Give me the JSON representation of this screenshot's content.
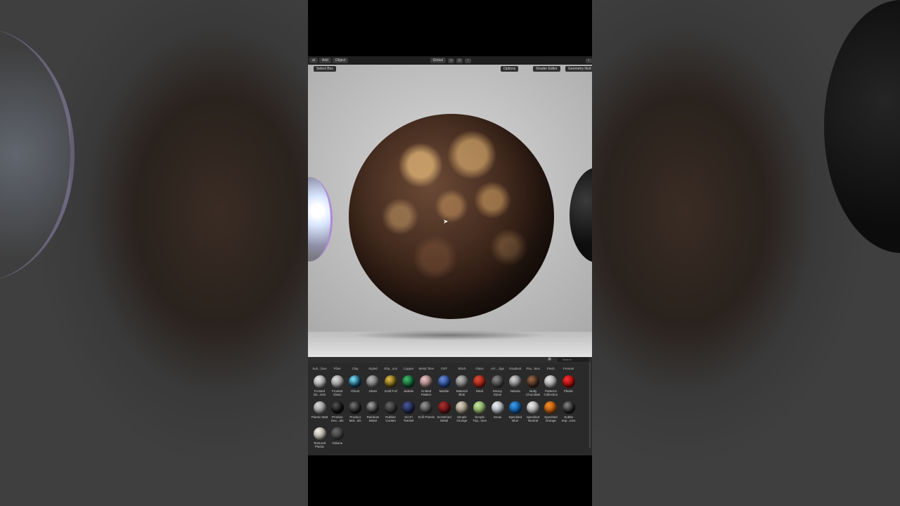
{
  "topbar": {
    "menu_first": "al",
    "menu_add": "Add",
    "menu_object": "Object",
    "transform_orientation": "Global"
  },
  "viewport": {
    "select_mode": "Select Box",
    "options_label": "Options",
    "shader_editor_label": "Shader Editor",
    "geometry_nodes_label": "Geometry Nod"
  },
  "browser": {
    "search_placeholder": "Search",
    "partial_row": [
      "Suh...face",
      "Fiber",
      "Clay",
      "Styled",
      "Shp...ons",
      "Copper",
      "Metal Tiles",
      "CRT",
      "Stitch",
      "Glass",
      "AO ...dge",
      "Gradient",
      "Pito...lass",
      "Flesh",
      "Fresnel"
    ],
    "assets": [
      {
        "label": "Frosted Dir...ions",
        "color": "#9a9a9a",
        "hl": "#e6e6e6"
      },
      {
        "label": "Frosted Glass",
        "color": "#8d8d8d",
        "hl": "#dcdcdc"
      },
      {
        "label": "Ghost",
        "color": "#0d3b55",
        "hl": "#7fe8ff"
      },
      {
        "label": "Glass",
        "color": "#666",
        "hl": "#bbb"
      },
      {
        "label": "Gold Foil",
        "color": "#5a4a10",
        "hl": "#e8c24a"
      },
      {
        "label": "Jadeite",
        "color": "#0e4a2a",
        "hl": "#3fbf6f"
      },
      {
        "label": "Knitted Pattern",
        "color": "#8a6a6a",
        "hl": "#f0c8c8"
      },
      {
        "label": "Marble",
        "color": "#1f3a7a",
        "hl": "#6a8ed8"
      },
      {
        "label": "Material Blob",
        "color": "#6a6a6a",
        "hl": "#c0c0c0"
      },
      {
        "label": "Meat",
        "color": "#8a1a10",
        "hl": "#e0503a"
      },
      {
        "label": "Mossy Stone",
        "color": "#3a3a3a",
        "hl": "#8a8a8a"
      },
      {
        "label": "Nebula",
        "color": "#6a6a6a",
        "hl": "#d8d8d8"
      },
      {
        "label": "Nutty Chocolate",
        "color": "#3a2418",
        "hl": "#9a6a4a"
      },
      {
        "label": "Patterns Collection",
        "color": "#9a9a9a",
        "hl": "#e6e6e6"
      },
      {
        "label": "Plastic",
        "color": "#8a0a0a",
        "hl": "#ff3030"
      },
      {
        "label": "Plastic Matt",
        "color": "#8a8a8a",
        "hl": "#dadada"
      },
      {
        "label": "Product Dec...als",
        "color": "#0a0a0a",
        "hl": "#555"
      },
      {
        "label": "Product Mat...als",
        "color": "#1a1a1a",
        "hl": "#777"
      },
      {
        "label": "Rainbow Metal",
        "color": "#2a2a2a",
        "hl": "#aaa"
      },
      {
        "label": "Rubber Curtain",
        "color": "#2a2a2a",
        "hl": "#666"
      },
      {
        "label": "Sci-Fi Trackel",
        "color": "#1a2040",
        "hl": "#4a5a9a"
      },
      {
        "label": "Scifi Panels",
        "color": "#3a3a3a",
        "hl": "#9a9a9a"
      },
      {
        "label": "Scratched Metal",
        "color": "#5a1010",
        "hl": "#b03030"
      },
      {
        "label": "Simple Grunge",
        "color": "#8a8070",
        "hl": "#e0d8c8"
      },
      {
        "label": "Simple Trip...ston",
        "color": "#7a9a5a",
        "hl": "#c8e8a0"
      },
      {
        "label": "Snow",
        "color": "#9aa0a8",
        "hl": "#eef2f6"
      },
      {
        "label": "Speckled Blue",
        "color": "#0a4a8a",
        "hl": "#3aa0f0"
      },
      {
        "label": "Speckled Neutral",
        "color": "#9a9a9a",
        "hl": "#f0f0f0"
      },
      {
        "label": "Speckled Orange",
        "color": "#a04a0a",
        "hl": "#f8902a"
      },
      {
        "label": "Subtle Imp...ions",
        "color": "#1a1a1a",
        "hl": "#888"
      },
      {
        "label": "Textured Plastic",
        "color": "#aaa59a",
        "hl": "#f4f0e6"
      },
      {
        "label": "Volume",
        "color": "#3a3a3a",
        "hl": "#6a6a6a"
      }
    ]
  }
}
